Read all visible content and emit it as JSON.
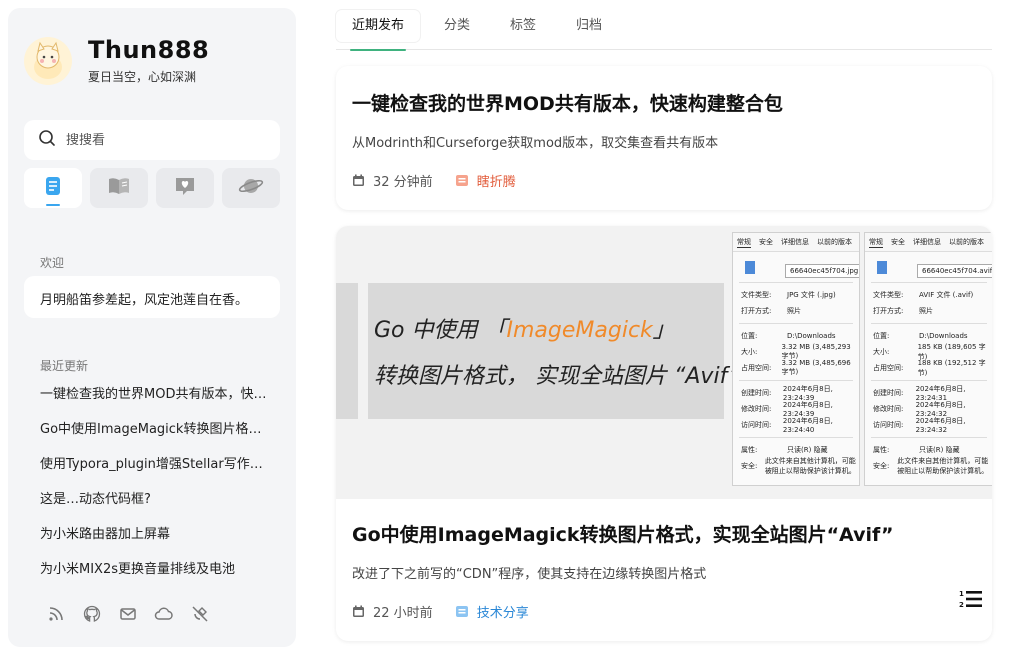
{
  "profile": {
    "title": "Thun888",
    "subtitle": "夏日当空，心如深渊"
  },
  "search": {
    "placeholder": "搜搜看"
  },
  "sidebar": {
    "welcome_label": "欢迎",
    "welcome_text": "月明船笛参差起，风定池莲自在香。",
    "recent_label": "最近更新",
    "recent": [
      "一键检查我的世界MOD共有版本，快速构建整合包",
      "Go中使用ImageMagick转换图片格式，实现全站图片“Avif”",
      "使用Typora_plugin增强Stellar写作体验",
      "这是…动态代码框?",
      "为小米路由器加上屏幕",
      "为小米MIX2s更换音量排线及电池"
    ]
  },
  "tabs": [
    "近期发布",
    "分类",
    "标签",
    "归档"
  ],
  "posts": [
    {
      "title": "一键检查我的世界MOD共有版本，快速构建整合包",
      "desc": "从Modrinth和Curseforge获取mod版本，取交集查看共有版本",
      "time": "32 分钟前",
      "category": "瞎折腾"
    },
    {
      "title": "Go中使用ImageMagick转换图片格式，实现全站图片“Avif”",
      "desc": "改进了下之前写的“CDN”程序，使其支持在边缘转换图片格式",
      "time": "22 小时前",
      "category": "技术分享",
      "cover": {
        "line1_a": "Go 中使用 「",
        "line1_hl": "ImageMagick",
        "line1_b": "」",
        "line2": "转换图片格式，  实现全站图片 “Avif”",
        "dialog1": {
          "tabs": [
            "常规",
            "安全",
            "详细信息",
            "以前的版本"
          ],
          "filename": "66640ec45f704.jpg",
          "rows": [
            [
              "文件类型:",
              "JPG 文件 (.jpg)"
            ],
            [
              "打开方式:",
              "照片"
            ],
            [
              "位置:",
              "D:\\Downloads"
            ],
            [
              "大小:",
              "3.32 MB (3,485,293 字节)"
            ],
            [
              "占用空间:",
              "3.32 MB (3,485,696 字节)"
            ],
            [
              "创建时间:",
              "2024年6月8日, 23:24:39"
            ],
            [
              "修改时间:",
              "2024年6月8日, 23:24:39"
            ],
            [
              "访问时间:",
              "2024年6月8日, 23:24:40"
            ],
            [
              "属性:",
              "只读(R)  隐藏"
            ],
            [
              "安全:",
              "此文件来自其他计算机，可能被阻止以帮助保护该计算机。"
            ]
          ]
        },
        "dialog2": {
          "tabs": [
            "常规",
            "安全",
            "详细信息",
            "以前的版本"
          ],
          "filename": "66640ec45f704.avif",
          "rows": [
            [
              "文件类型:",
              "AVIF 文件 (.avif)"
            ],
            [
              "打开方式:",
              "照片"
            ],
            [
              "位置:",
              "D:\\Downloads"
            ],
            [
              "大小:",
              "185 KB (189,605 字节)"
            ],
            [
              "占用空间:",
              "188 KB (192,512 字节)"
            ],
            [
              "创建时间:",
              "2024年6月8日, 23:24:31"
            ],
            [
              "修改时间:",
              "2024年6月8日, 23:24:32"
            ],
            [
              "访问时间:",
              "2024年6月8日, 23:24:32"
            ],
            [
              "属性:",
              "只读(R)  隐藏"
            ],
            [
              "安全:",
              "此文件来自其他计算机，可能被阻止以帮助保护该计算机。"
            ]
          ]
        }
      }
    }
  ],
  "colors": {
    "accent_green": "#3fb27f",
    "accent_blue": "#3aa6ef",
    "category_red": "#e25c3b",
    "category_blue": "#2a87d6"
  },
  "icons": {
    "nav": [
      "document-icon",
      "book-icon",
      "heart-chat-icon",
      "planet-icon"
    ],
    "social": [
      "rss-icon",
      "github-icon",
      "mail-icon",
      "cloud-icon",
      "satellite-icon"
    ],
    "toc": "list-icon"
  }
}
